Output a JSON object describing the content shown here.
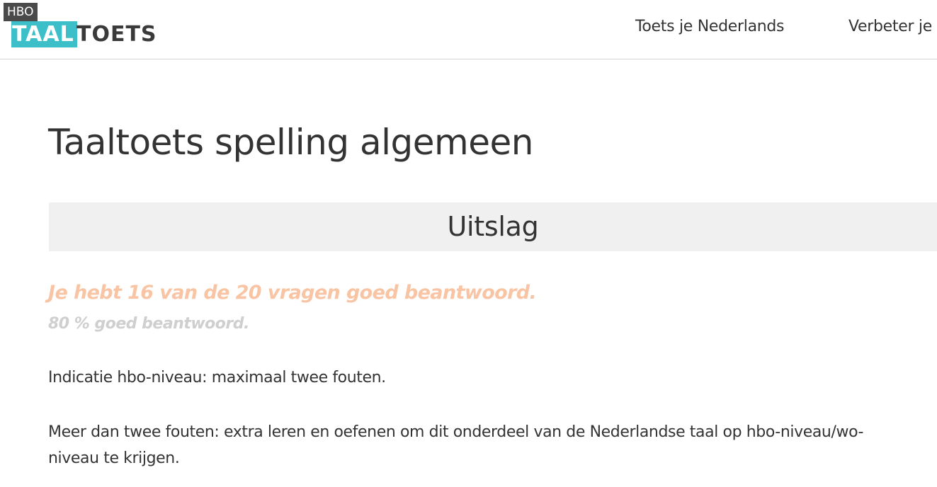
{
  "header": {
    "logo": {
      "hbo": "HBO",
      "taal": "TAAL",
      "toets": "TOETS"
    },
    "nav": [
      {
        "label": "Toets je Nederlands"
      },
      {
        "label": "Verbeter je"
      }
    ]
  },
  "main": {
    "title": "Taaltoets spelling algemeen",
    "result_heading": "Uitslag",
    "score_text": "Je hebt 16 van de 20 vragen goed beantwoord.",
    "percent_text": "80 % goed beantwoord.",
    "paragraphs": [
      "Indicatie hbo-niveau: maximaal twee fouten.",
      "Meer dan twee fouten: extra leren en oefenen om dit onderdeel van de Nederlandse taal op hbo-niveau/wo-niveau te krijgen."
    ]
  },
  "colors": {
    "logo_teal": "#3cbfc8",
    "logo_dark": "#4a4a4a",
    "score_orange": "#f9c4a3",
    "percent_gray": "#cfcfcf",
    "band_gray": "#f0f0f0"
  }
}
